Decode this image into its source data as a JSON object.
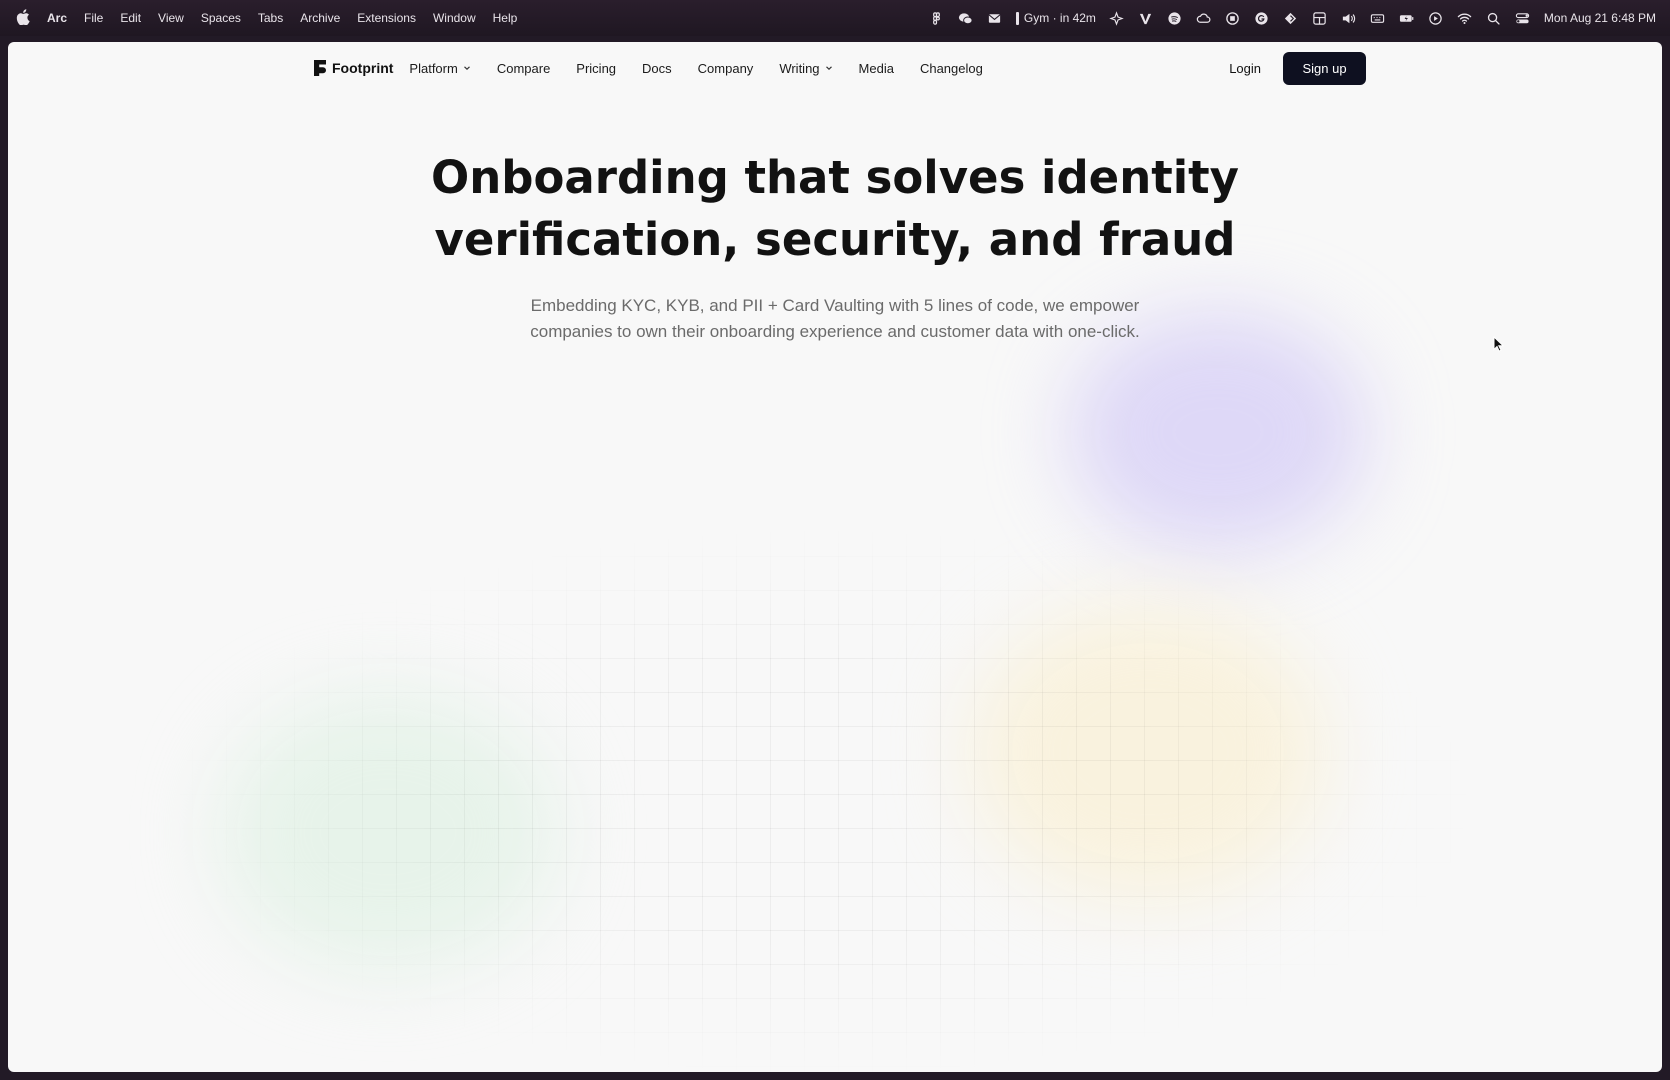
{
  "menubar": {
    "app_name": "Arc",
    "menus": [
      "File",
      "Edit",
      "View",
      "Spaces",
      "Tabs",
      "Archive",
      "Extensions",
      "Window",
      "Help"
    ],
    "calendar_event": "Gym · in 42m",
    "clock": "Mon Aug 21  6:48 PM",
    "tray_icons": [
      "figma-icon",
      "wechat-icon",
      "mail-icon",
      "calendar-icon",
      "sparkle-icon",
      "vectorworks-icon",
      "spotify-icon",
      "cloud-icon",
      "record-icon",
      "grammarly-icon",
      "kite-icon",
      "grid-icon",
      "volume-icon",
      "keyboard-icon",
      "battery-icon",
      "play-icon",
      "wifi-icon",
      "search-icon",
      "control-center-icon"
    ]
  },
  "nav": {
    "logo_text": "Footprint",
    "links": [
      {
        "label": "Platform",
        "dropdown": true
      },
      {
        "label": "Compare",
        "dropdown": false
      },
      {
        "label": "Pricing",
        "dropdown": false
      },
      {
        "label": "Docs",
        "dropdown": false
      },
      {
        "label": "Company",
        "dropdown": false
      },
      {
        "label": "Writing",
        "dropdown": true
      },
      {
        "label": "Media",
        "dropdown": false
      },
      {
        "label": "Changelog",
        "dropdown": false
      }
    ],
    "login_label": "Login",
    "signup_label": "Sign up"
  },
  "hero": {
    "title_line1": "Onboarding that solves identity",
    "title_line2": "verification, security, and fraud",
    "subtitle_line1": "Embedding KYC, KYB, and PII + Card Vaulting with 5 lines of code, we empower",
    "subtitle_line2": "companies to own their onboarding experience and customer data with one-click."
  },
  "colors": {
    "menubar_bg": "#221a26",
    "page_bg": "#f8f8f8",
    "signup_bg": "#0e1020",
    "heading": "#121212",
    "subtitle": "#6b6b6b"
  }
}
